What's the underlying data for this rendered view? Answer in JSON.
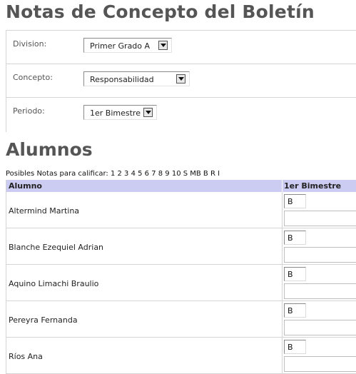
{
  "page": {
    "title": "Notas de Concepto del Boletín"
  },
  "filters": {
    "division": {
      "label": "Division:",
      "value": "Primer Grado A"
    },
    "concepto": {
      "label": "Concepto:",
      "value": "Responsabilidad"
    },
    "periodo": {
      "label": "Periodo:",
      "value": "1er Bimestre"
    }
  },
  "alumnos": {
    "title": "Alumnos",
    "hint": "Posibles Notas para calificar: 1 2 3 4 5 6 7 8 9 10 S MB B R I",
    "columns": {
      "alumno": "Alumno",
      "periodo": "1er Bimestre"
    },
    "rows": [
      {
        "name": "Altermind Martina",
        "grade": "B",
        "obs": ""
      },
      {
        "name": "Blanche Ezequiel Adrian",
        "grade": "B",
        "obs": ""
      },
      {
        "name": "Aquino Limachi Braulio",
        "grade": "B",
        "obs": ""
      },
      {
        "name": "Pereyra Fernanda",
        "grade": "B",
        "obs": ""
      },
      {
        "name": "Ríos Ana",
        "grade": "B",
        "obs": ""
      }
    ]
  },
  "icons": {
    "select_arrow": "chevron-down-icon"
  }
}
